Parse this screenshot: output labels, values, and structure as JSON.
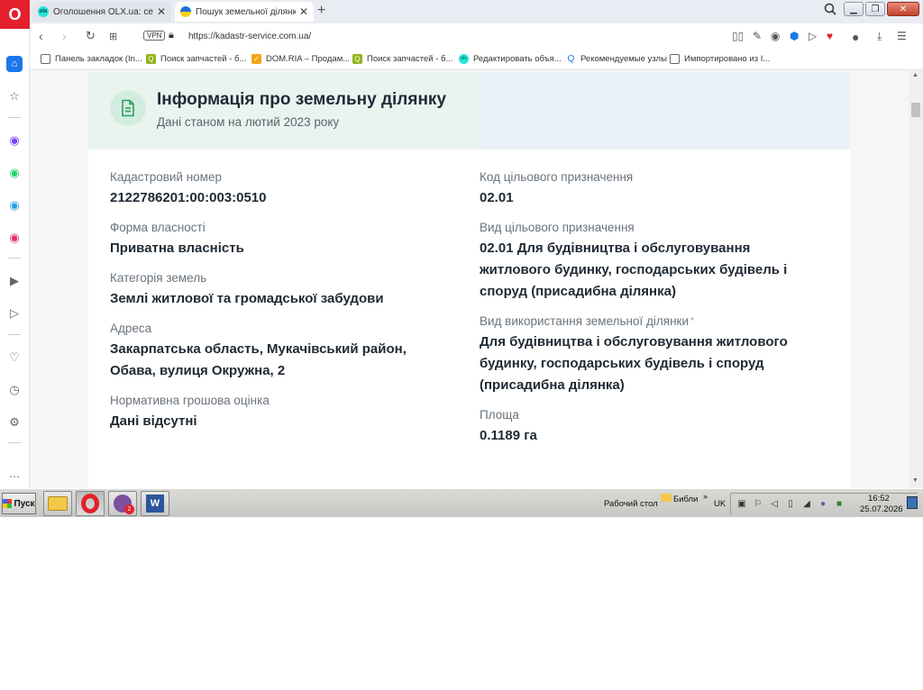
{
  "browser": {
    "tabs": [
      {
        "title": "Оголошення OLX.ua: сервіс",
        "favicon": "olx-icon",
        "active": false
      },
      {
        "title": "Пошук земельної ділянки в",
        "favicon": "ukraine-flag-icon",
        "active": true
      }
    ],
    "new_tab_label": "+",
    "url": "https://kadastr-service.com.ua/",
    "vpn_label": "VPN"
  },
  "bookmarks": [
    {
      "label": "Панель закладок (In...",
      "icon": "folder-icon"
    },
    {
      "label": "Поиск запчастей - б...",
      "icon": "parts-search-icon"
    },
    {
      "label": "DOM.RIA – Продам...",
      "icon": "domria-icon"
    },
    {
      "label": "Поиск запчастей - б...",
      "icon": "parts-search-icon"
    },
    {
      "label": "Редактировать объя...",
      "icon": "olx-icon"
    },
    {
      "label": "Рекомендуемые узлы",
      "icon": "search-icon"
    },
    {
      "label": "Импортировано из I...",
      "icon": "folder-icon"
    }
  ],
  "card": {
    "title": "Інформація про земельну ділянку",
    "subtitle": "Дані станом на лютий 2023 року",
    "left_fields": [
      {
        "label": "Кадастровий номер",
        "value": "2122786201:00:003:0510"
      },
      {
        "label": "Форма власності",
        "value": "Приватна власність"
      },
      {
        "label": "Категорія земель",
        "value": "Землі житлової та громадської забудови"
      },
      {
        "label": "Адреса",
        "value_lines": [
          "Закарпатська область, Мукачівський район,",
          "Обава, вулиця Окружна, 2"
        ]
      },
      {
        "label": "Нормативна грошова оцінка",
        "value": "Дані відсутні"
      }
    ],
    "right_fields": [
      {
        "label": "Код цільового призначення",
        "value": "02.01"
      },
      {
        "label": "Вид цільового призначення",
        "value_lines": [
          "02.01 Для будівництва і обслуговування",
          "житлового будинку, господарських будівель і",
          "споруд (присадибна ділянка)"
        ]
      },
      {
        "label": "Вид використання земельної ділянки",
        "asterisk": "*",
        "value_lines": [
          "Для будівництва і обслуговування житлового",
          "будинку, господарських будівель і споруд",
          "(присадибна ділянка)"
        ]
      },
      {
        "label": "Площа",
        "value": "0.1189 га"
      }
    ]
  },
  "taskbar": {
    "start_label": "Пуск",
    "desktop_label": "Рабочий стол",
    "library_label": "Библи",
    "chevron": "»",
    "language": "UK",
    "time": "16:52",
    "date": "25.07.2026",
    "viber_badge": "2"
  },
  "colors": {
    "opera_red": "#e3202c",
    "header_green": "#eaf4ef",
    "header_blue": "#eaf1f7",
    "doc_icon_green": "#2f9e5f"
  }
}
